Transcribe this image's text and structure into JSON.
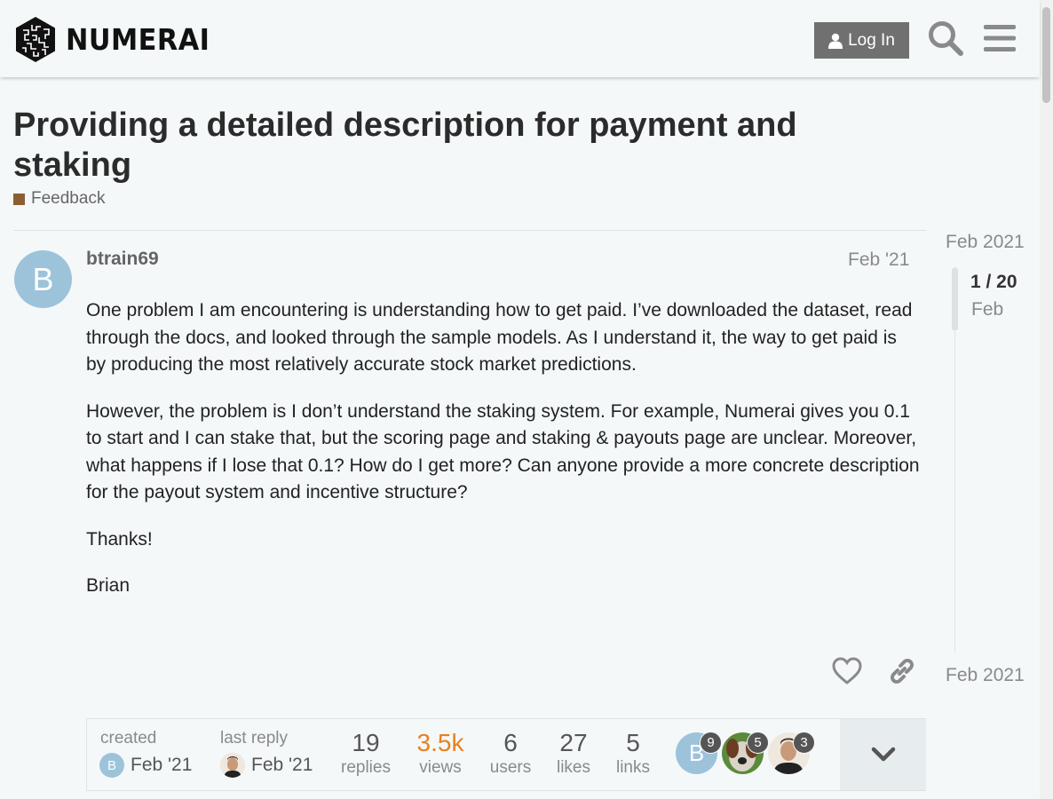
{
  "header": {
    "logo_text": "NUMERAI",
    "login_label": "Log In",
    "search_icon": "search-icon",
    "menu_icon": "hamburger-menu-icon"
  },
  "topic": {
    "title": "Providing a detailed description for payment and staking",
    "category": "Feedback",
    "category_color": "#8b5e33"
  },
  "post": {
    "avatar_letter": "B",
    "avatar_color": "#9dc3db",
    "username": "btrain69",
    "date": "Feb '21",
    "paragraphs": [
      "One problem I am encountering is understanding how to get paid. I’ve downloaded the dataset, read through the docs, and looked through the sample models. As I understand it, the way to get paid is by producing the most relatively accurate stock market predictions.",
      "However, the problem is I don’t understand the staking system. For example, Numerai gives you 0.1 to start and I can stake that, but the scoring page and staking & payouts page are unclear. Moreover, what happens if I lose that 0.1? How do I get more? Can anyone provide a more concrete description for the payout system and incentive structure?",
      "Thanks!",
      "Brian"
    ]
  },
  "topic_map": {
    "created_label": "created",
    "created_date": "Feb '21",
    "created_avatar": "B",
    "last_reply_label": "last reply",
    "last_reply_date": "Feb '21",
    "stats": [
      {
        "num": "19",
        "label": "replies"
      },
      {
        "num": "3.5k",
        "label": "views"
      },
      {
        "num": "6",
        "label": "users"
      },
      {
        "num": "27",
        "label": "likes"
      },
      {
        "num": "5",
        "label": "links"
      }
    ],
    "participants": [
      {
        "letter": "B",
        "count": "9"
      },
      {
        "letter": "",
        "count": "5"
      },
      {
        "letter": "",
        "count": "3"
      }
    ]
  },
  "timeline": {
    "top_date": "Feb 2021",
    "position": "1 / 20",
    "position_date": "Feb",
    "bottom_date": "Feb 2021"
  }
}
